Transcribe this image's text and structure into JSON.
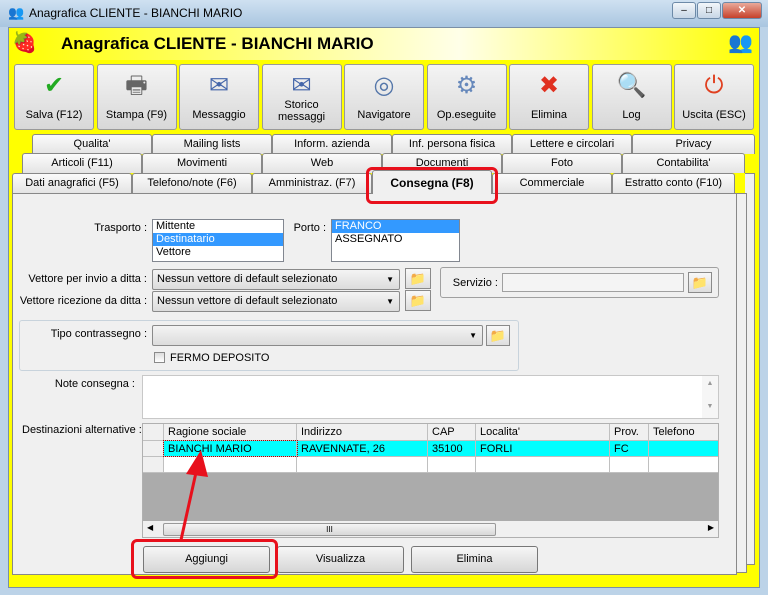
{
  "window": {
    "title": "Anagrafica CLIENTE - BIANCHI MARIO",
    "minimize": "–",
    "maximize": "□",
    "close": "✕"
  },
  "header": {
    "title": "Anagrafica CLIENTE - BIANCHI MARIO"
  },
  "toolbar": [
    {
      "label": "Salva (F12)",
      "icon": "✔",
      "color": "#22aa22"
    },
    {
      "label": "Stampa (F9)",
      "icon": "🖶",
      "color": "#666666"
    },
    {
      "label": "Messaggio",
      "icon": "✉",
      "color": "#4466aa"
    },
    {
      "label": "Storico messaggi",
      "icon": "✉",
      "color": "#4466aa"
    },
    {
      "label": "Navigatore",
      "icon": "◎",
      "color": "#5577aa"
    },
    {
      "label": "Op.eseguite",
      "icon": "⚙",
      "color": "#6688bb"
    },
    {
      "label": "Elimina",
      "icon": "✖",
      "color": "#e03020"
    },
    {
      "label": "Log",
      "icon": "🔍",
      "color": "#2266cc"
    },
    {
      "label": "Uscita (ESC)",
      "icon": "⏻",
      "color": "#e04020"
    }
  ],
  "tabs": {
    "row1": [
      "Qualita'",
      "Mailing lists",
      "Inform. azienda",
      "Inf. persona fisica",
      "Lettere e circolari",
      "Privacy"
    ],
    "row2": [
      "Articoli (F11)",
      "Movimenti",
      "Web",
      "Documenti",
      "Foto",
      "Contabilita'"
    ],
    "row3": [
      "Dati anagrafici (F5)",
      "Telefono/note (F6)",
      "Amministraz. (F7)",
      "Consegna (F8)",
      "Commerciale",
      "Estratto conto (F10)"
    ],
    "active": "Consegna (F8)"
  },
  "form": {
    "trasporto_label": "Trasporto :",
    "trasporto_options": [
      "Mittente",
      "Destinatario",
      "Vettore"
    ],
    "trasporto_selected": "Destinatario",
    "porto_label": "Porto :",
    "porto_options": [
      "FRANCO",
      "ASSEGNATO"
    ],
    "porto_selected": "FRANCO",
    "vettore_invio_label": "Vettore per invio a ditta :",
    "vettore_invio_value": "Nessun vettore di default selezionato",
    "vettore_ricezione_label": "Vettore ricezione da ditta :",
    "vettore_ricezione_value": "Nessun vettore di default selezionato",
    "servizio_label": "Servizio :",
    "servizio_value": "",
    "contrassegno_label": "Tipo contrassegno :",
    "contrassegno_value": "",
    "fermo_label": "FERMO DEPOSITO",
    "fermo_checked": false,
    "note_label": "Note consegna :",
    "note_value": "",
    "dest_label": "Destinazioni alternative :"
  },
  "grid": {
    "columns": [
      "Ragione sociale",
      "Indirizzo",
      "CAP",
      "Localita'",
      "Prov.",
      "Telefono"
    ],
    "rows": [
      [
        "BIANCHI MARIO",
        "RAVENNATE, 26",
        "35100",
        "FORLI",
        "FC",
        ""
      ]
    ],
    "scroll_grip": "III"
  },
  "buttons": {
    "add": "Aggiungi",
    "view": "Visualizza",
    "delete": "Elimina"
  }
}
